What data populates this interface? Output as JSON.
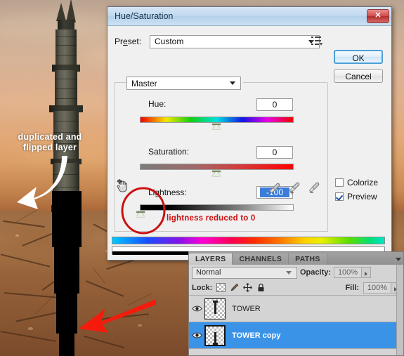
{
  "photo": {
    "annotation_white": "duplicated and flipped layer",
    "white_arrow_icon": "curved-arrow-icon",
    "red_arrow_icon": "red-arrow-icon",
    "tower_alt": "gothic stone tower",
    "ground_alt": "cracked desert ground"
  },
  "dialog": {
    "title": "Hue/Saturation",
    "close_label": "✕",
    "preset": {
      "label": "Preset:",
      "label_prefix": "Pr",
      "label_underlined": "e",
      "label_suffix": "set:",
      "value": "Custom",
      "menu_icon": "preset-menu-icon"
    },
    "buttons": {
      "ok": "OK",
      "cancel": "Cancel"
    },
    "channel": "Master",
    "sliders": [
      {
        "label": "Hue:",
        "value": "0",
        "selected": false,
        "thumb_pct": 50
      },
      {
        "label": "Saturation:",
        "value": "0",
        "selected": false,
        "thumb_pct": 50
      },
      {
        "label": "Lightness:",
        "value": "-100",
        "selected": true,
        "thumb_pct": 0
      }
    ],
    "hand_icon": "on-image-adjust-hand-icon",
    "eyedroppers": [
      "eyedropper-icon",
      "eyedropper-plus-icon",
      "eyedropper-minus-icon"
    ],
    "checkboxes": [
      {
        "label": "Colorize",
        "checked": false
      },
      {
        "label": "Preview",
        "checked": true
      }
    ],
    "annotation_red": "lightness reduced to 0"
  },
  "layers_panel": {
    "tabs": [
      {
        "label": "LAYERS",
        "active": true
      },
      {
        "label": "CHANNELS",
        "active": false
      },
      {
        "label": "PATHS",
        "active": false
      }
    ],
    "menu_icon": "panel-menu-icon",
    "blend_mode": "Normal",
    "opacity_label": "Opacity:",
    "opacity_value": "100%",
    "lock_label": "Lock:",
    "lock_icons": [
      "lock-transparency-icon",
      "lock-image-icon",
      "lock-position-icon",
      "lock-all-icon"
    ],
    "fill_label": "Fill:",
    "fill_value": "100%",
    "layers": [
      {
        "name": "TOWER",
        "visible": true,
        "selected": false,
        "eye_icon": "eye-icon"
      },
      {
        "name": "TOWER copy",
        "visible": true,
        "selected": true,
        "eye_icon": "eye-icon"
      }
    ]
  },
  "colors": {
    "selection_blue": "#3b93e8",
    "annotation_red": "#cc1111",
    "title_blue": "#b4d0ea",
    "value_highlight": "#3b7dd8"
  }
}
